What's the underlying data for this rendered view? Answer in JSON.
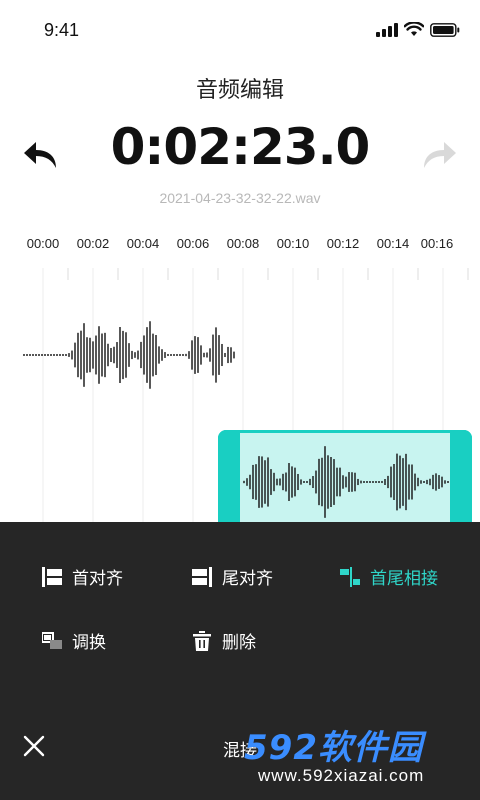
{
  "status": {
    "time": "9:41"
  },
  "header": {
    "title": "音频编辑"
  },
  "player": {
    "timer": "0:02:23.0",
    "filename": "2021-04-23-32-32-22.wav"
  },
  "ruler": {
    "labels": [
      "00:00",
      "00:02",
      "00:04",
      "00:06",
      "00:08",
      "00:10",
      "00:12",
      "00:14",
      "00:16"
    ]
  },
  "sheet": {
    "actions": [
      {
        "label": "首对齐",
        "icon": "align-start-icon",
        "active": false
      },
      {
        "label": "尾对齐",
        "icon": "align-end-icon",
        "active": false
      },
      {
        "label": "首尾相接",
        "icon": "head-tail-join-icon",
        "active": true
      },
      {
        "label": "调换",
        "icon": "swap-icon",
        "active": false
      },
      {
        "label": "删除",
        "icon": "trash-icon",
        "active": false
      }
    ],
    "title": "混接"
  },
  "colors": {
    "accent": "#2fd6c9",
    "sheet_bg": "#262626",
    "clip_fill": "#c8f4f0",
    "clip_border": "#19cfc2"
  },
  "watermark": {
    "logo": "592软件园",
    "url": "www.592xiazai.com"
  }
}
